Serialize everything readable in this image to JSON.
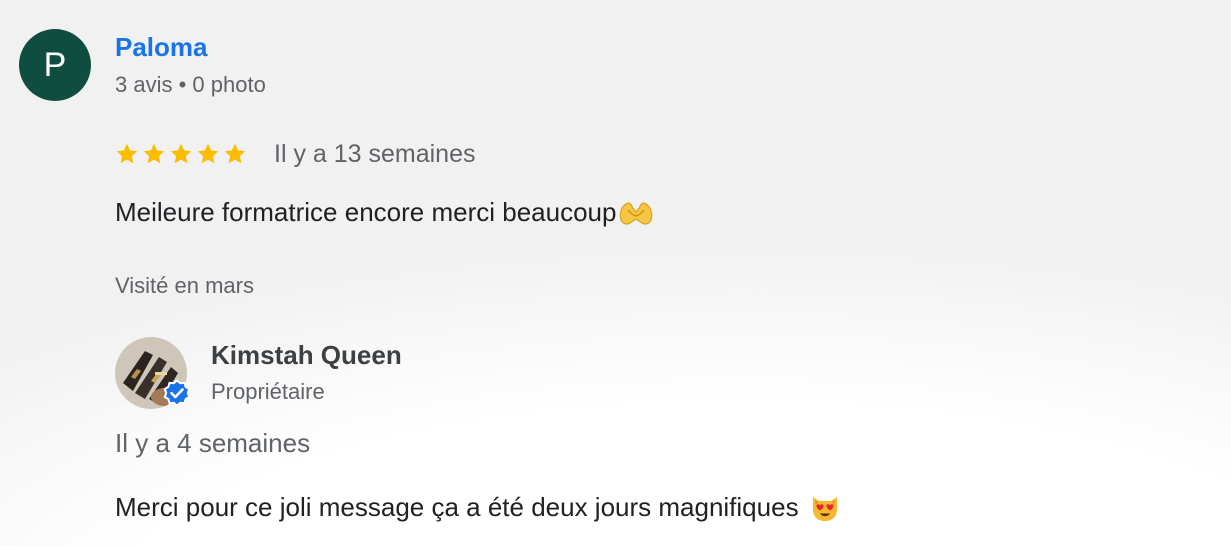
{
  "review": {
    "avatar_letter": "P",
    "avatar_color": "#0e4d3f",
    "reviewer_name": "Paloma",
    "reviewer_meta": "3 avis • 0 photo",
    "rating": 5,
    "max_rating": 5,
    "star_color": "#fbbc04",
    "date": "Il y a 13 semaines",
    "text": "Meileure formatrice encore merci beaucoup",
    "text_emoji": "heart-hands-icon",
    "visited": "Visité en mars"
  },
  "owner_reply": {
    "avatar": "owner-photo",
    "badge": "verified-badge-icon",
    "badge_color": "#1a73e8",
    "name": "Kimstah Queen",
    "role": "Propriétaire",
    "date": "Il y a 4 semaines",
    "text": "Merci pour ce joli message ça a été deux jours magnifiques",
    "text_emoji": "heart-eyes-cat-icon"
  },
  "colors": {
    "name_link": "#1a73e8",
    "secondary_text": "#5f6368",
    "primary_text": "#202124"
  }
}
